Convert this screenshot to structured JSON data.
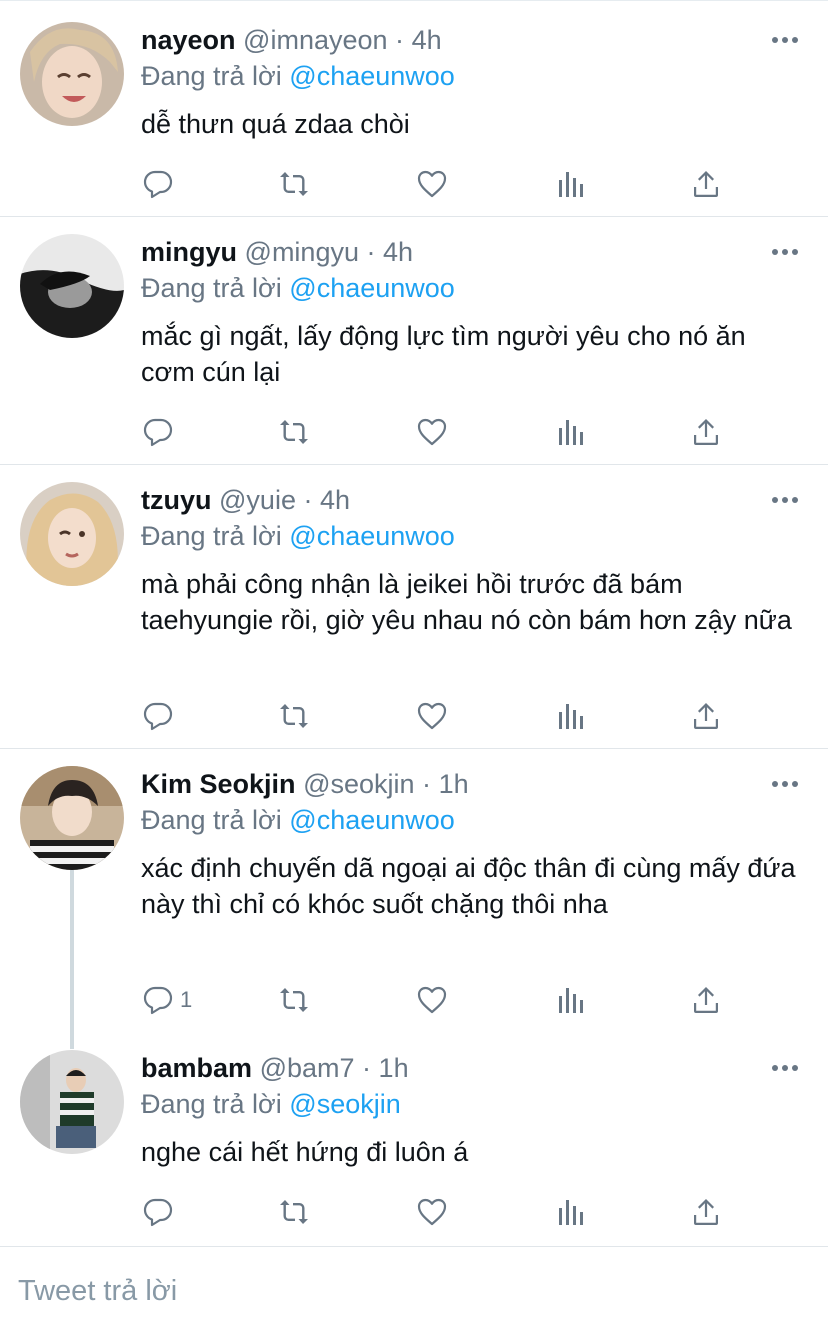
{
  "labels": {
    "replying_to": "Đang trả lời"
  },
  "tweets": [
    {
      "name": "nayeon",
      "handle": "@imnayeon",
      "sep": "·",
      "time": "4h",
      "mention": "@chaeunwoo",
      "text": "dễ thưn quá zdaa chòi",
      "reply_count": ""
    },
    {
      "name": "mingyu",
      "handle": "@mingyu",
      "sep": "·",
      "time": "4h",
      "mention": "@chaeunwoo",
      "text": "mắc gì ngất, lấy động lực tìm người yêu cho nó ăn cơm cún lại",
      "reply_count": ""
    },
    {
      "name": "tzuyu",
      "handle": "@yuie",
      "sep": "·",
      "time": "4h",
      "mention": "@chaeunwoo",
      "text": "mà phải công nhận là jeikei hồi trước đã bám taehyungie rồi, giờ yêu nhau nó còn bám hơn zậy nữa",
      "reply_count": ""
    },
    {
      "name": "Kim Seokjin",
      "handle": "@seokjin",
      "sep": "·",
      "time": "1h",
      "mention": "@chaeunwoo",
      "text": "xác định chuyến dã ngoại ai độc thân đi cùng mấy đứa này thì chỉ có khóc suốt chặng thôi nha",
      "reply_count": "1"
    },
    {
      "name": "bambam",
      "handle": "@bam7",
      "sep": "·",
      "time": "1h",
      "mention": "@seokjin",
      "text": "nghe cái hết hứng đi luôn á",
      "reply_count": ""
    }
  ],
  "compose": {
    "placeholder": "Tweet trả lời"
  },
  "icons": [
    "reply-icon",
    "retweet-icon",
    "like-icon",
    "analytics-icon",
    "share-icon",
    "more-icon"
  ],
  "colors": {
    "mention": "#1da1f2",
    "secondary": "#687684",
    "divider": "#e1e6ea"
  }
}
